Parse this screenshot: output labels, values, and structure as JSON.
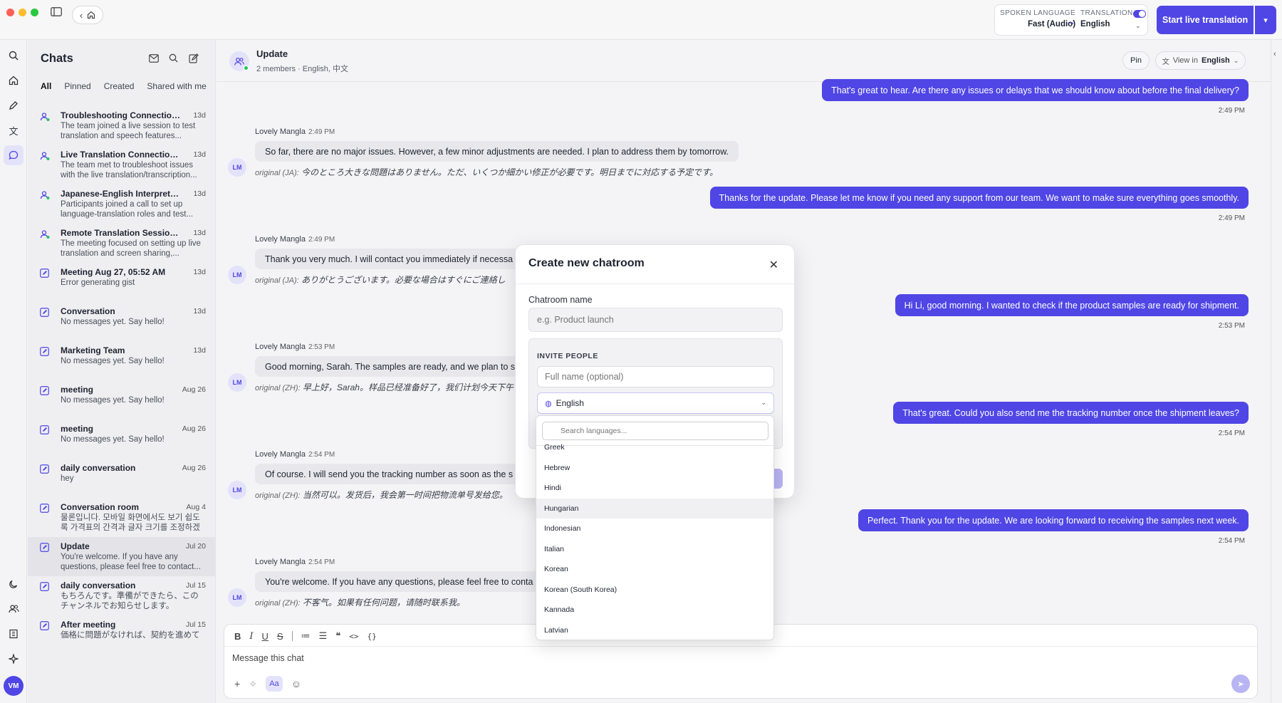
{
  "titlebar": {
    "spoken_language_label": "SPOKEN LANGUAGE",
    "spoken_language_value": "Fast (Audio)",
    "translation_label": "TRANSLATION",
    "translation_value": "English",
    "start_button": "Start live translation"
  },
  "chats": {
    "title": "Chats",
    "filters": [
      "All",
      "Pinned",
      "Created",
      "Shared with me"
    ],
    "items": [
      {
        "title": "Troubleshooting Connection an...",
        "date": "13d",
        "sub": "The team joined a live session to test translation and speech features...",
        "icon": "meeting-person-icon"
      },
      {
        "title": "Live Translation Connection Tro...",
        "date": "13d",
        "sub": "The team met to troubleshoot issues with the live translation/transcription...",
        "icon": "meeting-person-icon"
      },
      {
        "title": "Japanese-English Interpreter Co...",
        "date": "13d",
        "sub": "Participants joined a call to set up language-translation roles and test...",
        "icon": "meeting-person-icon"
      },
      {
        "title": "Remote Translation Session Set...",
        "date": "13d",
        "sub": "The meeting focused on setting up live translation and screen sharing,...",
        "icon": "meeting-person-icon"
      },
      {
        "title": "Meeting Aug 27, 05:52 AM",
        "date": "13d",
        "sub": "Error generating gist",
        "icon": "edit-square-icon"
      },
      {
        "title": "Conversation",
        "date": "13d",
        "sub": "No messages yet. Say hello!",
        "icon": "edit-square-icon"
      },
      {
        "title": "Marketing Team",
        "date": "13d",
        "sub": "No messages yet. Say hello!",
        "icon": "edit-square-icon"
      },
      {
        "title": "meeting",
        "date": "Aug 26",
        "sub": "No messages yet. Say hello!",
        "icon": "edit-square-icon"
      },
      {
        "title": "meeting",
        "date": "Aug 26",
        "sub": "No messages yet. Say hello!",
        "icon": "edit-square-icon"
      },
      {
        "title": "daily conversation",
        "date": "Aug 26",
        "sub": "hey",
        "icon": "edit-square-icon"
      },
      {
        "title": "Conversation room",
        "date": "Aug 4",
        "sub": "물론입니다. 모바일 화면에서도 보기 쉽도록 가격표의 간격과 글자 크기를 조정하겠습니...",
        "icon": "edit-square-icon"
      },
      {
        "title": "Update",
        "date": "Jul 20",
        "sub": "You're welcome. If you have any questions, please feel free to contact...",
        "icon": "edit-square-icon"
      },
      {
        "title": "daily conversation",
        "date": "Jul 15",
        "sub": "もちろんです。準備ができたら、このチャンネルでお知らせします。",
        "icon": "edit-square-icon"
      },
      {
        "title": "After meeting",
        "date": "Jul 15",
        "sub": "価格に問題がなければ、契約を進めて",
        "icon": "edit-square-icon"
      }
    ]
  },
  "room": {
    "title": "Update",
    "subtitle": "2 members · English, 中文",
    "pin": "Pin",
    "view_in_label": "View in",
    "view_in_value": "English"
  },
  "messages": {
    "out": [
      {
        "text": "That's great to hear. Are there any issues or delays that we should know about before the final delivery?",
        "time": "2:49 PM"
      },
      {
        "text": "Thanks for the update. Please let me know if you need any support from our team. We want to make sure everything goes smoothly.",
        "time": "2:49 PM"
      },
      {
        "text": "Hi Li, good morning. I wanted to check if the product samples are ready for shipment.",
        "time": "2:53 PM"
      },
      {
        "text": "That's great. Could you also send me the tracking number once the shipment leaves?",
        "time": "2:54 PM"
      },
      {
        "text": "Perfect. Thank you for the update. We are looking forward to receiving the samples next week.",
        "time": "2:54 PM"
      }
    ],
    "in": [
      {
        "name": "Lovely Mangla",
        "time": "2:49 PM",
        "avatar": "LM",
        "text": "So far, there are no major issues. However, a few minor adjustments are needed. I plan to address them by tomorrow.",
        "orig_label": "original (JA):",
        "orig": "今のところ大きな問題はありません。ただ、いくつか細かい修正が必要です。明日までに対応する予定です。"
      },
      {
        "name": "Lovely Mangla",
        "time": "2:49 PM",
        "avatar": "LM",
        "text": "Thank you very much. I will contact you immediately if necessa",
        "orig_label": "original (JA):",
        "orig": "ありがとうございます。必要な場合はすぐにご連絡し"
      },
      {
        "name": "Lovely Mangla",
        "time": "2:53 PM",
        "avatar": "LM",
        "text": "Good morning, Sarah. The samples are ready, and we plan to s",
        "orig_label": "original (ZH):",
        "orig": "早上好，Sarah。样品已经准备好了，我们计划今天下午"
      },
      {
        "name": "Lovely Mangla",
        "time": "2:54 PM",
        "avatar": "LM",
        "text": "Of course. I will send you the tracking number as soon as the s",
        "orig_label": "original (ZH):",
        "orig": "当然可以。发货后，我会第一时间把物流单号发给您。"
      },
      {
        "name": "Lovely Mangla",
        "time": "2:54 PM",
        "avatar": "LM",
        "text": "You're welcome. If you have any questions, please feel free to conta",
        "orig_label": "original (ZH):",
        "orig": "不客气。如果有任何问题，请随时联系我。"
      }
    ]
  },
  "composer": {
    "placeholder": "Message this chat",
    "aa": "Aa"
  },
  "modal": {
    "title": "Create new chatroom",
    "name_label": "Chatroom name",
    "name_placeholder": "e.g. Product launch",
    "invite_label": "INVITE PEOPLE",
    "fullname_placeholder": "Full name (optional)",
    "language_value": "English"
  },
  "dropdown": {
    "search_placeholder": "Search languages...",
    "options": [
      "Greek",
      "Hebrew",
      "Hindi",
      "Hungarian",
      "Indonesian",
      "Italian",
      "Korean",
      "Korean (South Korea)",
      "Kannada",
      "Latvian"
    ],
    "hovered": "Hungarian"
  },
  "user": {
    "initials": "VM"
  },
  "colors": {
    "accent": "#4f46e5",
    "online": "#22c55e"
  }
}
